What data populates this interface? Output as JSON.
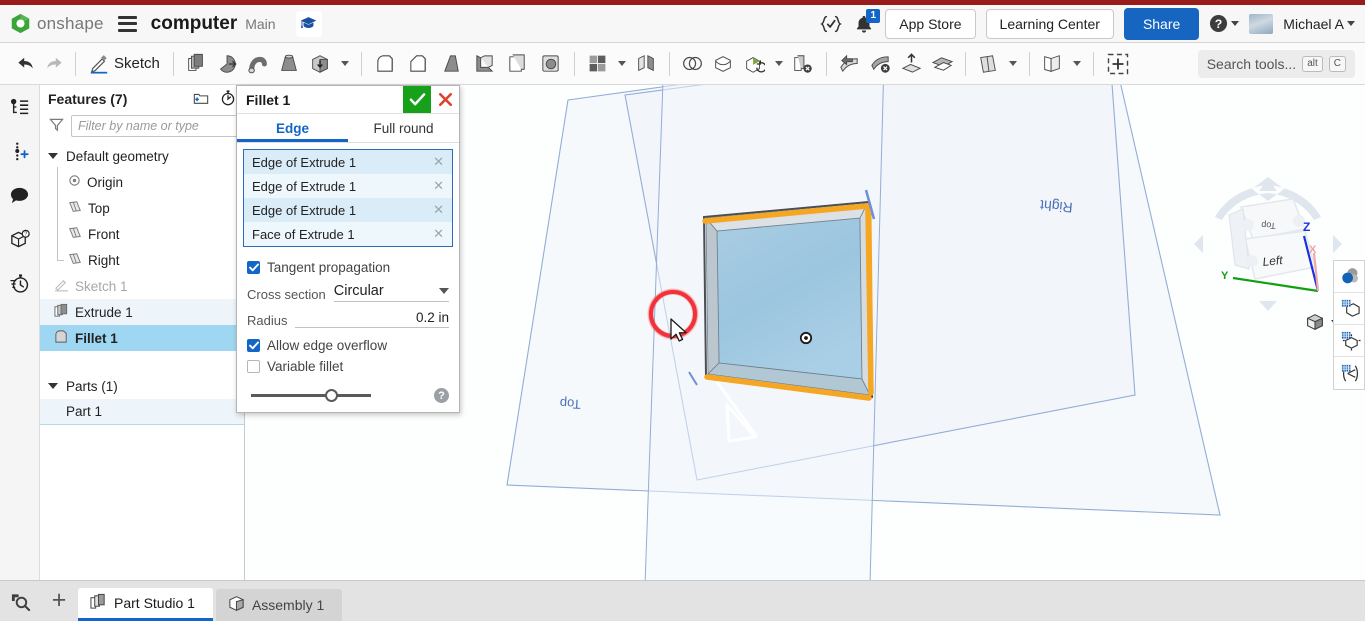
{
  "header": {
    "brand": "onshape",
    "menu_icon": "hamburger-icon",
    "document_title": "computer",
    "branch": "Main",
    "learning_icon": "graduation-cap-icon",
    "comment_check_icon": "check-braces-icon",
    "notification_icon": "bell-icon",
    "notification_count": "1",
    "app_store_label": "App Store",
    "learning_center_label": "Learning Center",
    "share_label": "Share",
    "help_icon": "question-mark-icon",
    "user_name": "Michael A",
    "avatar_icon": "user-avatar"
  },
  "toolbar": {
    "undo_icon": "undo-arrow-icon",
    "redo_icon": "redo-arrow-icon",
    "sketch_label": "Sketch",
    "sketch_icon": "pencil-icon",
    "items": [
      {
        "name": "extrude-tool",
        "icon": "extrude-icon"
      },
      {
        "name": "revolve-tool",
        "icon": "revolve-icon"
      },
      {
        "name": "sweep-tool",
        "icon": "sweep-icon"
      },
      {
        "name": "loft-tool",
        "icon": "loft-icon"
      },
      {
        "name": "thicken-tool",
        "icon": "thicken-box-icon"
      },
      {
        "name": "fillet-tool",
        "icon": "fillet-icon"
      },
      {
        "name": "chamfer-tool",
        "icon": "chamfer-icon"
      },
      {
        "name": "draft-tool",
        "icon": "draft-icon"
      },
      {
        "name": "shell-tool",
        "icon": "shell-icon"
      },
      {
        "name": "hole-tool",
        "icon": "hole-icon"
      },
      {
        "name": "pattern-tool",
        "icon": "pattern-grid-icon"
      },
      {
        "name": "mirror-tool",
        "icon": "mirror-icon"
      },
      {
        "name": "boolean-tool",
        "icon": "boolean-circles-icon"
      },
      {
        "name": "split-tool",
        "icon": "split-icon"
      },
      {
        "name": "transform-tool",
        "icon": "transform-icon"
      },
      {
        "name": "delete-part-tool",
        "icon": "delete-part-icon"
      },
      {
        "name": "move-face-tool",
        "icon": "move-face-icon"
      },
      {
        "name": "delete-face-tool",
        "icon": "delete-face-icon"
      },
      {
        "name": "replace-face-tool",
        "icon": "replace-face-icon"
      },
      {
        "name": "offset-surface-tool",
        "icon": "offset-surface-icon"
      },
      {
        "name": "plane-tool",
        "icon": "plane-icon"
      },
      {
        "name": "sheet-metal-tool",
        "icon": "sheet-metal-icon"
      },
      {
        "name": "insert-tool",
        "icon": "insert-crosshair-icon"
      }
    ],
    "search_placeholder": "Search tools...",
    "search_kbd_alt": "alt",
    "search_kbd_key": "C"
  },
  "left_rail": [
    {
      "name": "feature-list-icon",
      "label": "Feature list"
    },
    {
      "name": "add-variable-icon",
      "label": "Variables"
    },
    {
      "name": "comments-icon",
      "label": "Comments"
    },
    {
      "name": "part-info-icon",
      "label": "Part info"
    },
    {
      "name": "history-icon",
      "label": "History"
    }
  ],
  "tree": {
    "title": "Features (7)",
    "folder_icon": "new-folder-icon",
    "rollback_icon": "rollback-timer-icon",
    "filter_icon": "funnel-icon",
    "filter_placeholder": "Filter by name or type",
    "filter_value": "",
    "items": [
      {
        "label": "Default geometry",
        "icon": "chevron-down-icon",
        "level": 0,
        "state": "normal"
      },
      {
        "label": "Origin",
        "icon": "origin-icon",
        "level": 1,
        "state": "normal"
      },
      {
        "label": "Top",
        "icon": "plane-icon",
        "level": 1,
        "state": "normal"
      },
      {
        "label": "Front",
        "icon": "plane-icon",
        "level": 1,
        "state": "normal"
      },
      {
        "label": "Right",
        "icon": "plane-icon",
        "level": 1,
        "state": "normal"
      },
      {
        "label": "Sketch 1",
        "icon": "sketch-icon",
        "level": 0,
        "state": "dim"
      },
      {
        "label": "Extrude 1",
        "icon": "extrude-icon",
        "level": 0,
        "state": "highlight"
      },
      {
        "label": "Fillet 1",
        "icon": "fillet-icon",
        "level": 0,
        "state": "selected"
      }
    ],
    "parts_title": "Parts (1)",
    "parts": [
      {
        "label": "Part 1",
        "icon": "part-icon"
      }
    ]
  },
  "dialog": {
    "title": "Fillet 1",
    "accept_icon": "checkmark-icon",
    "cancel_icon": "x-close-icon",
    "tabs": [
      {
        "label": "Edge",
        "active": true
      },
      {
        "label": "Full round",
        "active": false
      }
    ],
    "selections": [
      {
        "label": "Edge of Extrude 1",
        "remove_icon": "x-remove-icon"
      },
      {
        "label": "Edge of Extrude 1",
        "remove_icon": "x-remove-icon"
      },
      {
        "label": "Edge of Extrude 1",
        "remove_icon": "x-remove-icon"
      },
      {
        "label": "Face of Extrude 1",
        "remove_icon": "x-remove-icon"
      }
    ],
    "tangent_propagation_label": "Tangent propagation",
    "tangent_propagation_checked": true,
    "cross_section_label": "Cross section",
    "cross_section_value": "Circular",
    "radius_label": "Radius",
    "radius_value": "0.2 in",
    "allow_edge_overflow_label": "Allow edge overflow",
    "allow_edge_overflow_checked": true,
    "variable_fillet_label": "Variable fillet",
    "variable_fillet_checked": false,
    "help_icon": "question-mark-icon",
    "slider_position_pct": 62
  },
  "viewport": {
    "plane_labels": [
      {
        "name": "top-plane-label",
        "text": "Top"
      },
      {
        "name": "right-plane-label",
        "text": "Right"
      }
    ],
    "cursor_icon": "mouse-pointer",
    "click_highlight": "red-click-ring",
    "selected_edge_color": "#f5a623",
    "part_face_color": "#9dc6e0",
    "plane_line_color": "#8fa8d0"
  },
  "viewcube": {
    "face_label": "Left",
    "top_label": "Top",
    "axis_x": "X",
    "axis_y": "Y",
    "axis_z": "Z",
    "view_dropdown_icon": "view-cube-icon"
  },
  "right_rail": [
    {
      "name": "display-state-icon",
      "label": "Display state"
    },
    {
      "name": "render-mode-icon",
      "label": "Render mode"
    },
    {
      "name": "explode-view-icon",
      "label": "Explode"
    },
    {
      "name": "section-view-icon",
      "label": "Section view"
    }
  ],
  "tabbar": {
    "zoom_icon": "zoom-search-icon",
    "add_tab_label": "+",
    "tabs": [
      {
        "label": "Part Studio 1",
        "icon": "part-studio-icon",
        "active": true
      },
      {
        "label": "Assembly 1",
        "icon": "assembly-icon",
        "active": false
      }
    ]
  },
  "colors": {
    "accent_blue": "#1366c7",
    "red_strip": "#991b1b",
    "accept_green": "#17a01a",
    "cancel_red": "#d9432f",
    "selection_highlight": "#9fd7f2",
    "fillet_edge_orange": "#f5a623"
  }
}
